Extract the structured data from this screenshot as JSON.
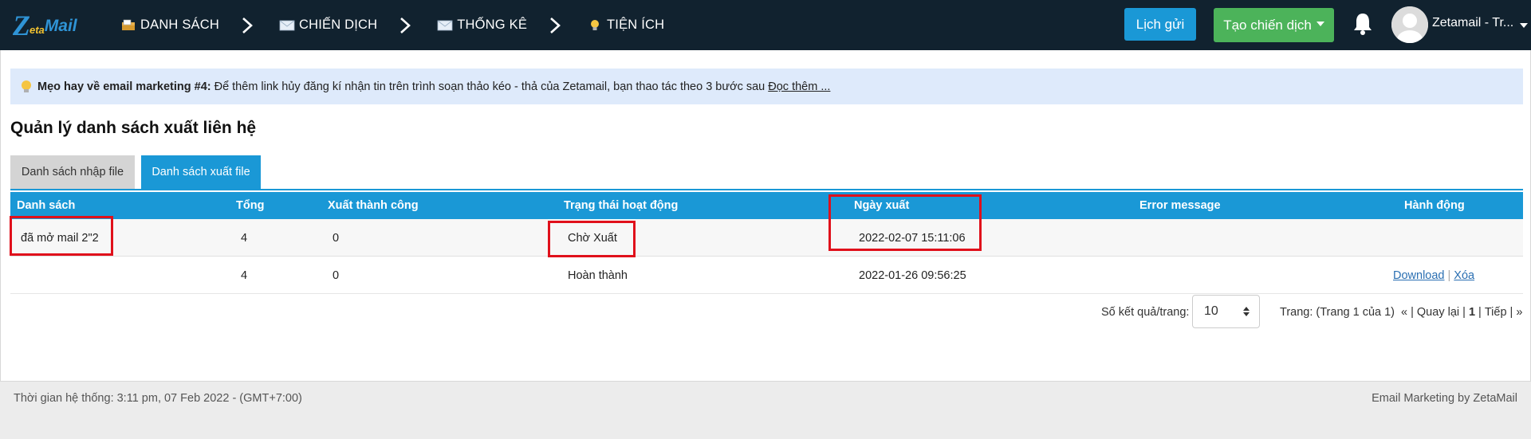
{
  "brand": {
    "logo_z": "Z",
    "logo_eta": "eta",
    "logo_mail": "Mail"
  },
  "nav": [
    {
      "label": "DANH SÁCH",
      "icon": "list-folder-icon"
    },
    {
      "label": "CHIẾN DỊCH",
      "icon": "envelope-icon"
    },
    {
      "label": "THỐNG KÊ",
      "icon": "envelope-icon"
    },
    {
      "label": "TIỆN ÍCH",
      "icon": "lightbulb-icon"
    }
  ],
  "header": {
    "schedule_button": "Lịch gửi",
    "create_campaign_button": "Tạo chiến dịch",
    "username": "Zetamail - Tr..."
  },
  "tip": {
    "bold": "Mẹo hay về email marketing #4:",
    "text": "Để thêm link hủy đăng kí nhận tin trên trình soạn thảo kéo - thả của Zetamail, bạn thao tác theo 3 bước sau",
    "link": "Đọc thêm ..."
  },
  "page_title": "Quản lý danh sách xuất liên hệ",
  "tabs": {
    "import": "Danh sách nhập file",
    "export": "Danh sách xuất file",
    "active": "export"
  },
  "table": {
    "headers": [
      "Danh sách",
      "Tổng",
      "Xuất thành công",
      "Trạng thái hoạt động",
      "Ngày xuất",
      "Error message",
      "Hành động"
    ],
    "rows": [
      {
        "list": "đã mở mail 2\"2",
        "total": "4",
        "success": "0",
        "status": "Chờ Xuất",
        "date": "2022-02-07 15:11:06",
        "error": "",
        "download": "",
        "delete": ""
      },
      {
        "list": "",
        "total": "4",
        "success": "0",
        "status": "Hoàn thành",
        "date": "2022-01-26 09:56:25",
        "error": "",
        "download": "Download",
        "delete": "Xóa"
      }
    ]
  },
  "pagination": {
    "per_page_label": "Số kết quả/trang:",
    "per_page_value": "10",
    "page_info": "Trang: (Trang 1 của 1)",
    "first": "«",
    "prev": "Quay lại",
    "current": "1",
    "next": "Tiếp",
    "last": "»"
  },
  "footer": {
    "system_time": "Thời gian hệ thống: 3:11 pm, 07 Feb 2022 - (GMT+7:00)",
    "credit": "Email Marketing by ZetaMail"
  },
  "colors": {
    "topbar": "#11222f",
    "accent": "#1a98d6",
    "green": "#4cb35a",
    "highlight": "#e0101b"
  }
}
